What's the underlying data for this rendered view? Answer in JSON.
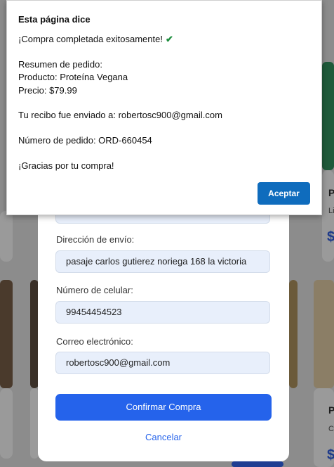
{
  "alert": {
    "title": "Esta página dice",
    "success": "¡Compra completada exitosamente!",
    "summary_header": "Resumen de pedido:",
    "product": "Producto: Proteína Vegana",
    "price": "Precio: $79.99",
    "receipt": "Tu recibo fue enviado a: robertosc900@gmail.com",
    "order_number": "Número de pedido: ORD-660454",
    "thanks": "¡Gracias por tu compra!",
    "ok_label": "Aceptar",
    "check_icon": "✔"
  },
  "form": {
    "address_label": "Dirección de envío:",
    "address_value": "pasaje carlos gutierez noriega 168 la victoria",
    "phone_label": "Número de celular:",
    "phone_value": "99454454523",
    "email_label": "Correo electrónico:",
    "email_value": "robertosc900@gmail.com",
    "confirm_label": "Confirmar Compra",
    "cancel_label": "Cancelar"
  },
  "background": {
    "right_card_title": "P",
    "right_card_sub": "Li",
    "right_card_price": "$",
    "right_card2_title": "P",
    "right_card2_sub": "C",
    "right_card2_price": "$"
  },
  "colors": {
    "primary": "#2563eb",
    "ok_button": "#0f6cbd",
    "success_check": "#1e8e3e"
  }
}
